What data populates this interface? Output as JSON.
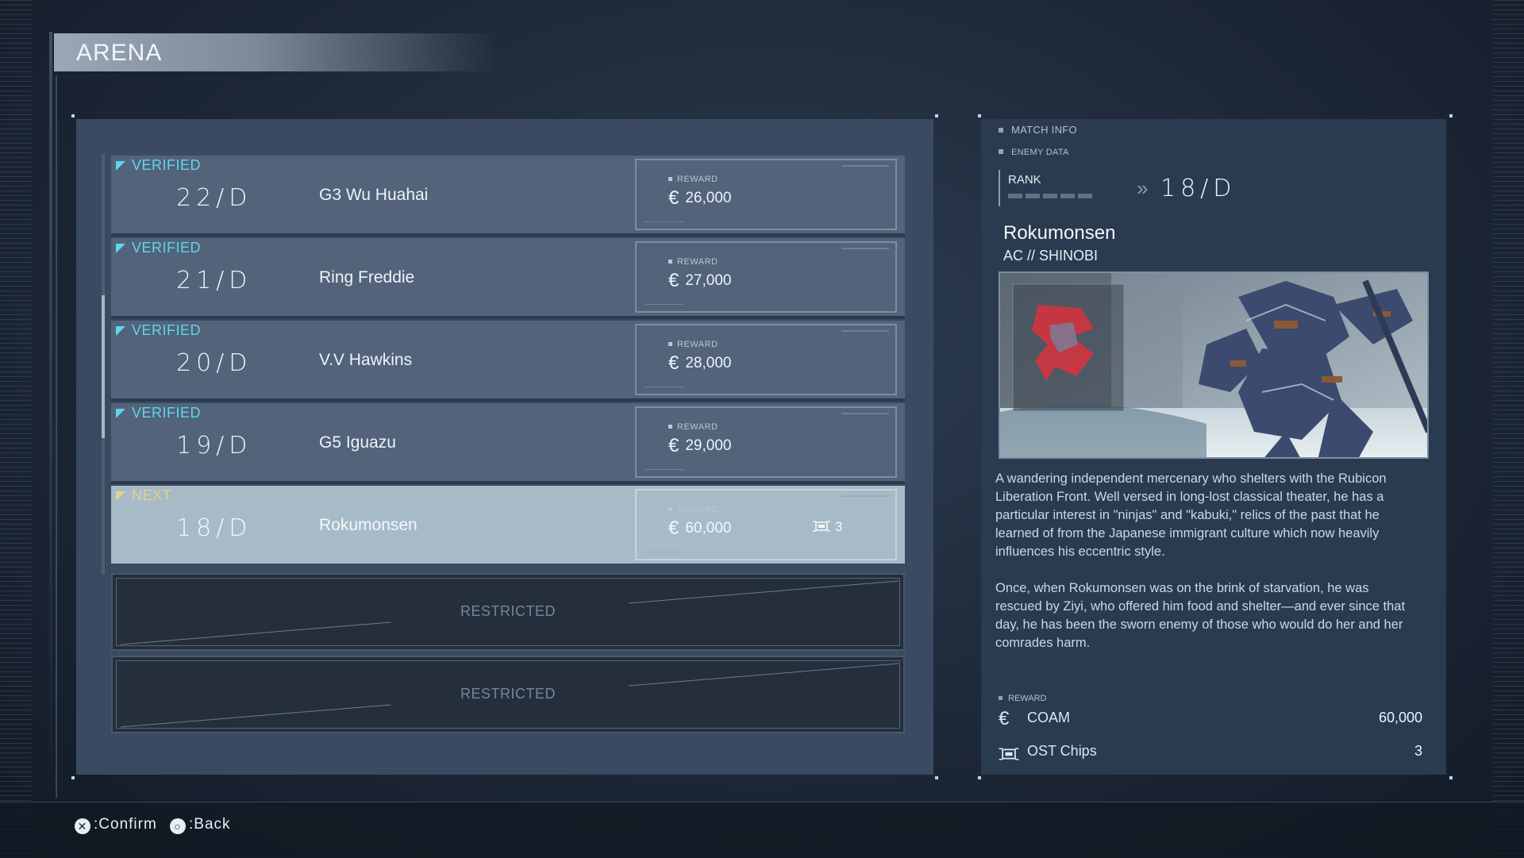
{
  "title": "ARENA",
  "matches": [
    {
      "status": "VERIFIED",
      "rank": "22/D",
      "name": "G3 Wu Huahai",
      "reward_label": "REWARD",
      "reward": "26,000"
    },
    {
      "status": "VERIFIED",
      "rank": "21/D",
      "name": "Ring Freddie",
      "reward_label": "REWARD",
      "reward": "27,000"
    },
    {
      "status": "VERIFIED",
      "rank": "20/D",
      "name": "V.V Hawkins",
      "reward_label": "REWARD",
      "reward": "28,000"
    },
    {
      "status": "VERIFIED",
      "rank": "19/D",
      "name": "G5 Iguazu",
      "reward_label": "REWARD",
      "reward": "29,000"
    },
    {
      "status": "NEXT",
      "rank": "18/D",
      "name": "Rokumonsen",
      "reward_label": "REWARD",
      "reward": "60,000",
      "chips": "3"
    }
  ],
  "restricted": [
    "RESTRICTED",
    "RESTRICTED"
  ],
  "currency_symbol": "€",
  "match_info": {
    "heading": "MATCH INFO",
    "enemy_heading": "ENEMY DATA",
    "rank_label": "RANK",
    "rank_value": "18/D",
    "pilot_name": "Rokumonsen",
    "ac_name": "AC // SHINOBI",
    "description_1": "A wandering independent mercenary who shelters with the Rubicon Liberation Front. Well versed in long-lost classical theater, he has a particular interest in \"ninjas\" and \"kabuki,\" relics of the past that he learned of from the Japanese immigrant culture which now heavily influences his eccentric style.",
    "description_2": "Once, when Rokumonsen was on the brink of starvation, he was rescued by Ziyi, who offered him food and shelter—and ever since that day, he has been the sworn enemy of those who would do her and her comrades harm.",
    "reward_heading": "REWARD",
    "coam_label": "COAM",
    "coam_value": "60,000",
    "chips_label": "OST Chips",
    "chips_value": "3"
  },
  "controls": {
    "confirm": ":Confirm",
    "back": ":Back"
  },
  "colors": {
    "verified": "#5fd6e8",
    "next": "#e8d08a",
    "panel": "#394a61",
    "highlight": "#a6bac8"
  }
}
